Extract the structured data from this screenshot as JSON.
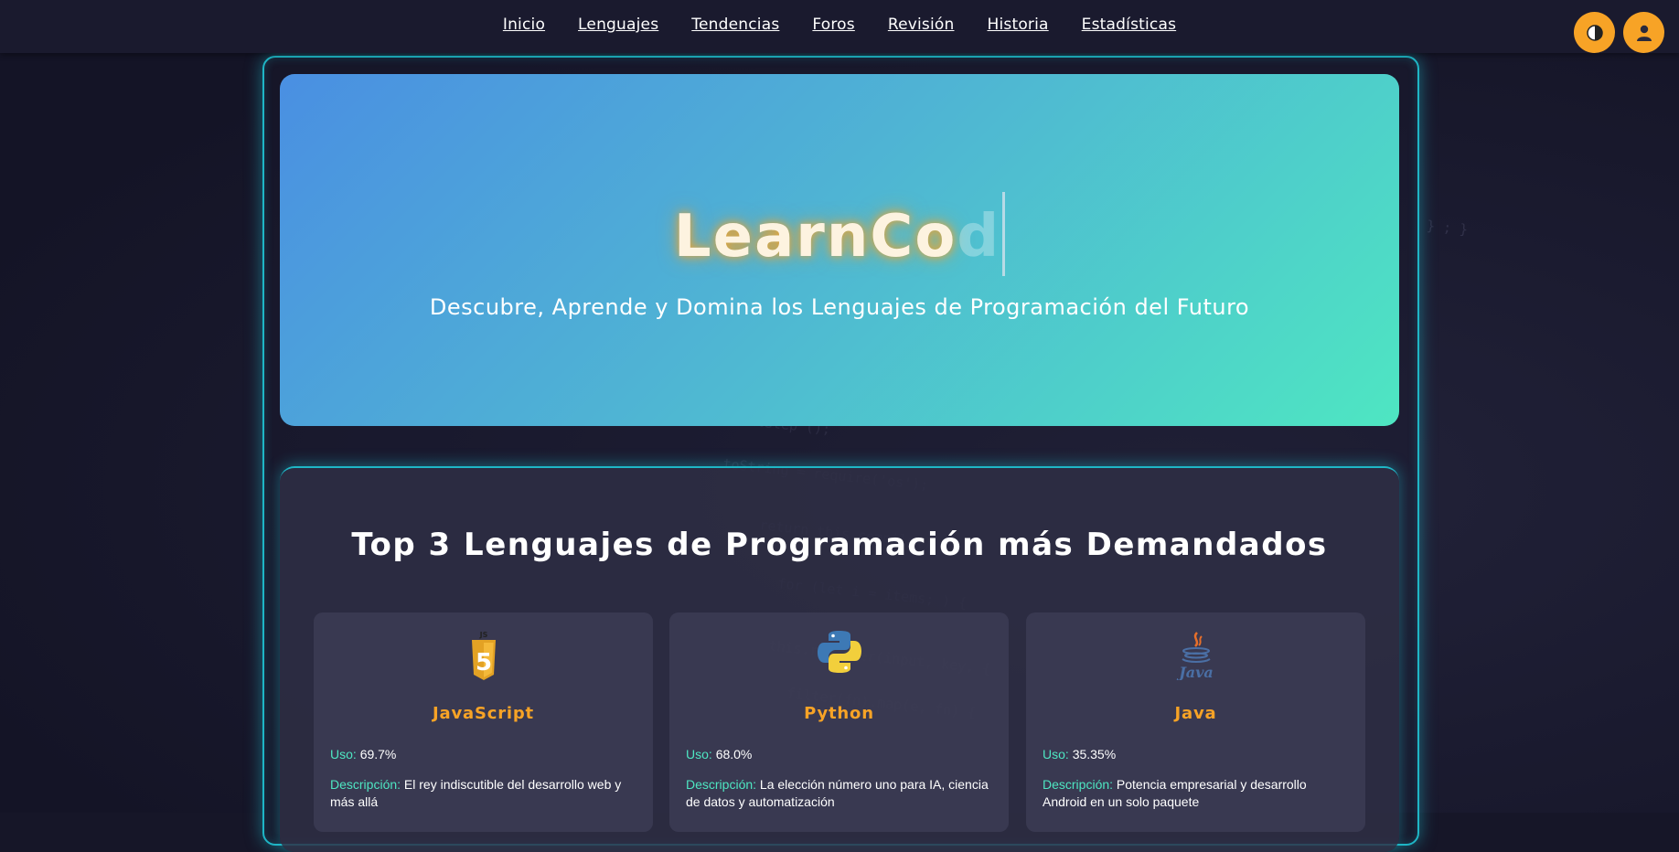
{
  "nav": {
    "links": [
      "Inicio",
      "Lenguajes",
      "Tendencias",
      "Foros",
      "Revisión",
      "Historia",
      "Estadísticas"
    ]
  },
  "hero": {
    "title_typed": "LearnCo",
    "title_partial": "d",
    "subtitle": "Descubre, Aprende y Domina los Lenguajes de Programación del Futuro"
  },
  "top": {
    "title": "Top 3 Lenguajes de Programación más Demandados",
    "uso_label": "Uso:",
    "desc_label": "Descripción:",
    "cards": [
      {
        "name": "JavaScript",
        "icon": "javascript-icon",
        "uso": "69.7%",
        "desc": "El rey indiscutible del desarrollo web y más allá"
      },
      {
        "name": "Python",
        "icon": "python-icon",
        "uso": "68.0%",
        "desc": "La elección número uno para IA, ciencia de datos y automatización"
      },
      {
        "name": "Java",
        "icon": "java-icon",
        "uso": "35.35%",
        "desc": "Potencia empresarial y desarrollo Android en un solo paquete"
      }
    ]
  },
  "colors": {
    "accent": "#f7a326",
    "teal": "#4ee6c2",
    "frame": "#1fb6c6",
    "background": "#161628"
  }
}
